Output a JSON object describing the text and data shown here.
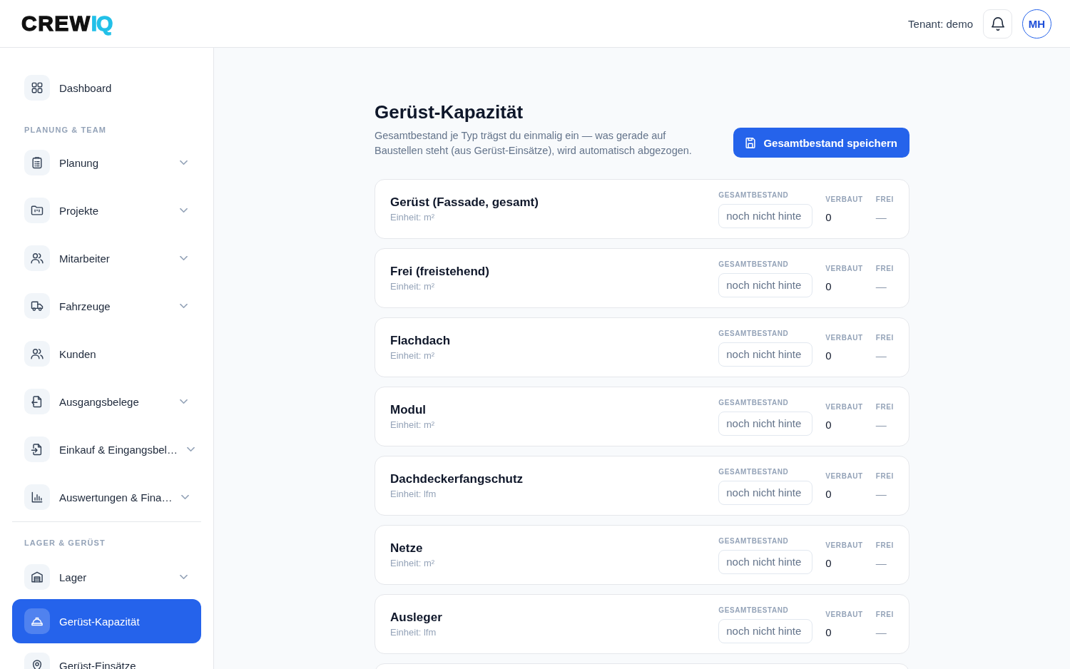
{
  "header": {
    "logo": {
      "text": "CREW",
      "accent": "IQ"
    },
    "tenant": "Tenant: demo",
    "avatar": "MH"
  },
  "sidebar": {
    "groups": [
      {
        "divided": false,
        "items": [
          {
            "label": "Dashboard",
            "expandable": false,
            "selected": false
          }
        ]
      },
      {
        "divided": false,
        "title": "PLANUNG & TEAM",
        "items": [
          {
            "label": "Planung",
            "expandable": true,
            "selected": false
          },
          {
            "label": "Projekte",
            "expandable": true,
            "selected": false
          },
          {
            "label": "Mitarbeiter",
            "expandable": true,
            "selected": false
          },
          {
            "label": "Fahrzeuge",
            "expandable": true,
            "selected": false
          },
          {
            "label": "Kunden",
            "expandable": false,
            "selected": false
          },
          {
            "label": "Ausgangsbelege",
            "expandable": true,
            "selected": false
          },
          {
            "label": "Einkauf & Eingangsbel…",
            "expandable": true,
            "selected": false
          },
          {
            "label": "Auswertungen & Fina…",
            "expandable": true,
            "selected": false
          }
        ]
      },
      {
        "divided": true,
        "title": "LAGER & GERÜST",
        "items": [
          {
            "label": "Lager",
            "expandable": true,
            "selected": false
          },
          {
            "label": "Gerüst-Kapazität",
            "expandable": false,
            "selected": true
          },
          {
            "label": "Gerüst-Einsätze",
            "expandable": false,
            "selected": false
          }
        ]
      }
    ]
  },
  "page": {
    "title": "Gerüst-Kapazität",
    "description": "Gesamtbestand je Typ trägst du einmalig ein — was gerade auf Baustellen steht (aus Gerüst-Einsätze), wird automatisch abgezogen.",
    "save_button": "Gesamtbestand speichern"
  },
  "cards": [
    {
      "name": "Gerüst (Fassade, gesamt)",
      "unit": "Einheit: m²",
      "total_label": "GESAMTBESTAND",
      "total_placeholder": "noch nicht hinte",
      "installed_label": "VERBAUT",
      "installed": "0",
      "free_label": "FREI",
      "free": "—"
    },
    {
      "name": "Frei (freistehend)",
      "unit": "Einheit: m²",
      "total_label": "GESAMTBESTAND",
      "total_placeholder": "noch nicht hinte",
      "installed_label": "VERBAUT",
      "installed": "0",
      "free_label": "FREI",
      "free": "—"
    },
    {
      "name": "Flachdach",
      "unit": "Einheit: m²",
      "total_label": "GESAMTBESTAND",
      "total_placeholder": "noch nicht hinte",
      "installed_label": "VERBAUT",
      "installed": "0",
      "free_label": "FREI",
      "free": "—"
    },
    {
      "name": "Modul",
      "unit": "Einheit: m²",
      "total_label": "GESAMTBESTAND",
      "total_placeholder": "noch nicht hinte",
      "installed_label": "VERBAUT",
      "installed": "0",
      "free_label": "FREI",
      "free": "—"
    },
    {
      "name": "Dachdeckerfangschutz",
      "unit": "Einheit: lfm",
      "total_label": "GESAMTBESTAND",
      "total_placeholder": "noch nicht hinte",
      "installed_label": "VERBAUT",
      "installed": "0",
      "free_label": "FREI",
      "free": "—"
    },
    {
      "name": "Netze",
      "unit": "Einheit: m²",
      "total_label": "GESAMTBESTAND",
      "total_placeholder": "noch nicht hinte",
      "installed_label": "VERBAUT",
      "installed": "0",
      "free_label": "FREI",
      "free": "—"
    },
    {
      "name": "Ausleger",
      "unit": "Einheit: lfm",
      "total_label": "GESAMTBESTAND",
      "total_placeholder": "noch nicht hinte",
      "installed_label": "VERBAUT",
      "installed": "0",
      "free_label": "FREI",
      "free": "—"
    }
  ]
}
